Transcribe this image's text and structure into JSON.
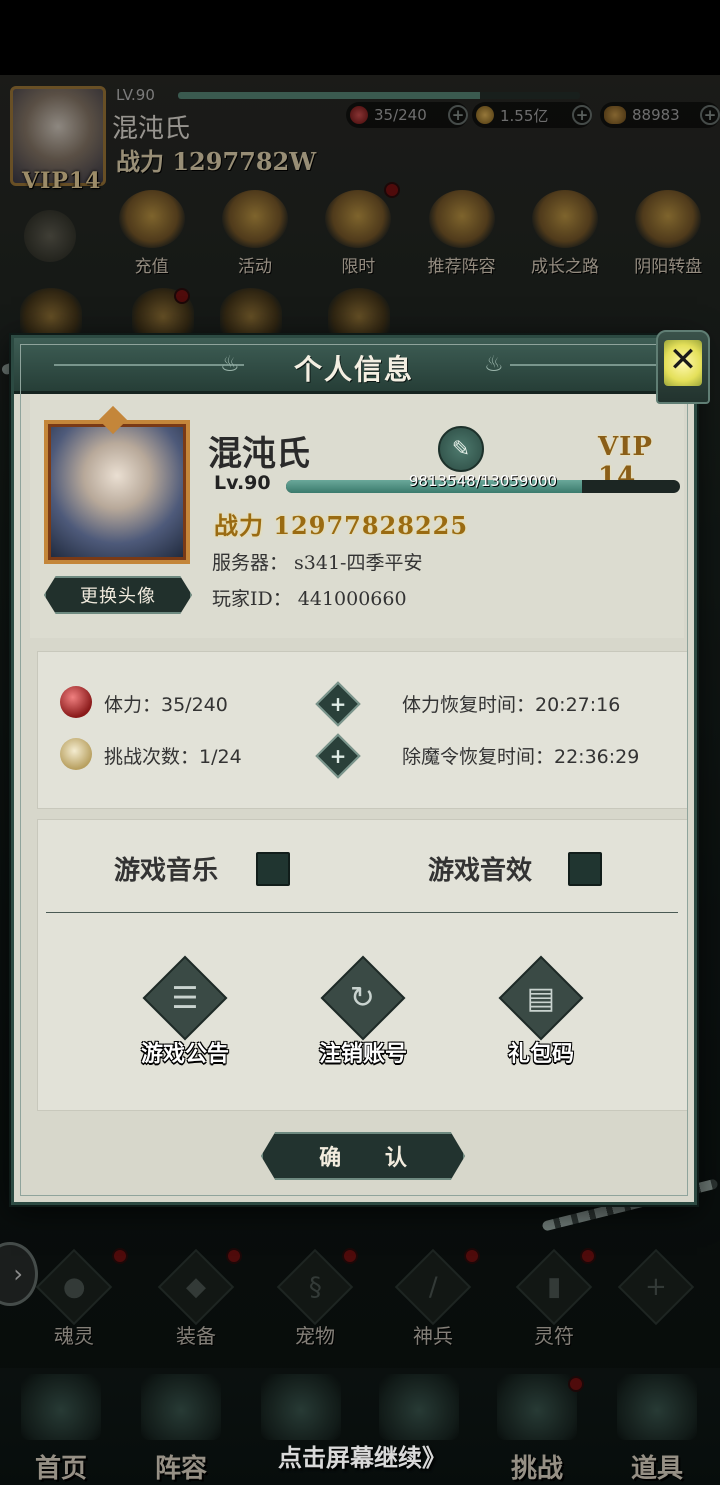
{
  "hud": {
    "vip": "VIP14",
    "level": "LV.90",
    "exp_fraction": 0.75,
    "name": "混沌氏",
    "power": "战力 1297782W",
    "resources": [
      {
        "icon": "stamina-orb-icon",
        "value": "35/240"
      },
      {
        "icon": "gold-coin-icon",
        "value": "1.55亿"
      },
      {
        "icon": "ingot-icon",
        "value": "88983"
      }
    ]
  },
  "top_menu": [
    {
      "label": "充值",
      "icon": "gold-ingot-icon",
      "badge": false
    },
    {
      "label": "活动",
      "icon": "activity-icon",
      "badge": false
    },
    {
      "label": "限时",
      "icon": "limited-time-icon",
      "badge": true
    },
    {
      "label": "推荐阵容",
      "icon": "recommended-lineup-icon",
      "badge": false
    },
    {
      "label": "成长之路",
      "icon": "growth-path-icon",
      "badge": false
    },
    {
      "label": "阴阳转盘",
      "icon": "yinyang-wheel-icon",
      "badge": false
    }
  ],
  "dialog": {
    "title": "个人信息",
    "close_icon": "close-icon",
    "name": "混沌氏",
    "vip": "VIP 14",
    "level": "Lv.90",
    "exp_current": 9813548,
    "exp_max": 13059000,
    "exp_text": "9813548/13059000",
    "power": "战力 12977828225",
    "server": "服务器： s341-四季平安",
    "player_id": "玩家ID： 441000660",
    "change_avatar": "更换头像",
    "stats": {
      "stamina_label": "体力：35/240",
      "stamina_recover": "体力恢复时间：20:27:16",
      "challenge_label": "挑战次数：1/24",
      "challenge_recover": "除魔令恢复时间：22:36:29"
    },
    "settings": {
      "music_label": "游戏音乐",
      "music_on": false,
      "sfx_label": "游戏音效",
      "sfx_on": false
    },
    "actions": [
      {
        "label": "游戏公告",
        "icon": "notice-board-icon"
      },
      {
        "label": "注销账号",
        "icon": "logout-refresh-icon"
      },
      {
        "label": "礼包码",
        "icon": "gift-code-icon"
      }
    ],
    "confirm": "确 认"
  },
  "sub_nav": [
    {
      "label": "魂灵",
      "icon": "soul-icon"
    },
    {
      "label": "装备",
      "icon": "equipment-icon"
    },
    {
      "label": "宠物",
      "icon": "pet-icon"
    },
    {
      "label": "神兵",
      "icon": "divine-weapon-icon"
    },
    {
      "label": "灵符",
      "icon": "talisman-icon"
    },
    {
      "label": "",
      "icon": "plus-icon"
    }
  ],
  "main_nav": [
    {
      "label": "首页",
      "icon": "home-icon"
    },
    {
      "label": "阵容",
      "icon": "lineup-icon"
    },
    {
      "label": "",
      "icon": "swords-icon"
    },
    {
      "label": "",
      "icon": "battle-icon"
    },
    {
      "label": "挑战",
      "icon": "challenge-scroll-icon"
    },
    {
      "label": "道具",
      "icon": "item-bag-icon"
    }
  ],
  "continue_hint": "点击屏幕继续》"
}
